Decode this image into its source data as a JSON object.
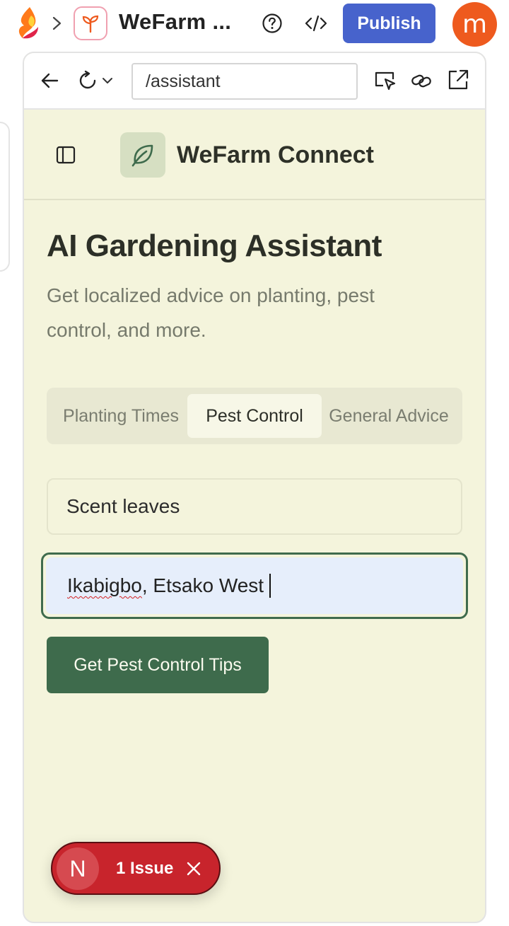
{
  "topbar": {
    "app_title": "WeFarm ...",
    "publish_label": "Publish",
    "avatar_initial": "m"
  },
  "browser": {
    "url": "/assistant"
  },
  "app": {
    "brand_name": "WeFarm Connect",
    "page_title": "AI Gardening Assistant",
    "page_subtitle": "Get localized advice on planting, pest control, and more.",
    "tabs": [
      {
        "label": "Planting Times",
        "active": false
      },
      {
        "label": "Pest Control",
        "active": true
      },
      {
        "label": "General Advice",
        "active": false
      }
    ],
    "plant_field_value": "Scent leaves",
    "location_value": {
      "misspelled": "Ikabigbo",
      "rest": ", Etsako West"
    },
    "submit_label": "Get Pest Control Tips"
  },
  "issue_badge": {
    "logo_letter": "N",
    "label": "1 Issue"
  },
  "colors": {
    "publish": "#4763cc",
    "avatar": "#ee5a1e",
    "app_background": "#f4f4dc",
    "primary_green": "#3e6b4c",
    "issue_red": "#c8242c"
  },
  "icons": [
    "brand-logo-icon",
    "chevron-right-icon",
    "sprout-icon",
    "help-icon",
    "code-icon",
    "back-arrow-icon",
    "reload-icon",
    "chevron-down-icon",
    "inspect-icon",
    "link-icon",
    "external-link-icon",
    "sidebar-icon",
    "leaf-icon",
    "close-icon"
  ]
}
